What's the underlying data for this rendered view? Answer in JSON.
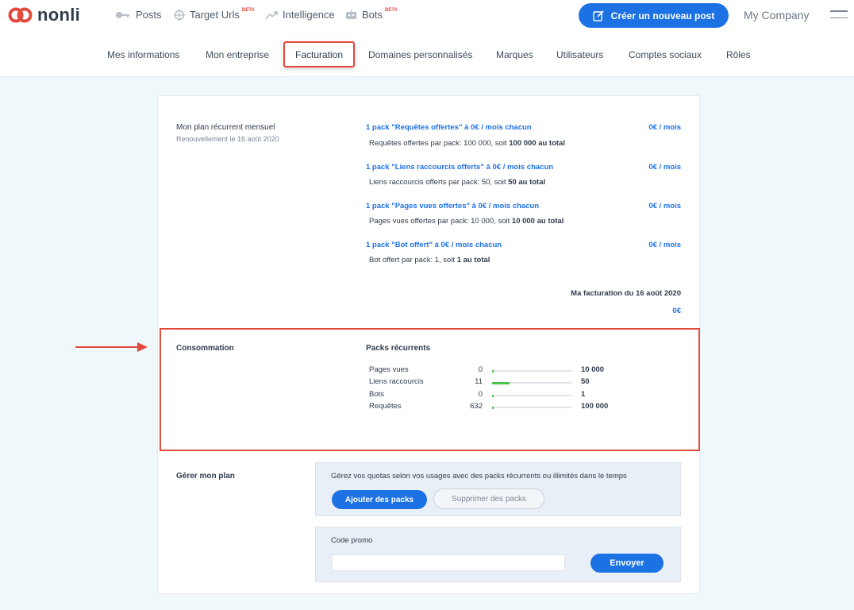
{
  "brand": {
    "name": "nonli",
    "color": "#e24a3e"
  },
  "nav": [
    {
      "label": "Posts",
      "icon": "key-icon",
      "beta": ""
    },
    {
      "label": "Target Urls",
      "icon": "crosshair-icon",
      "beta": "BETA"
    },
    {
      "label": "Intelligence",
      "icon": "trend-icon",
      "beta": ""
    },
    {
      "label": "Bots",
      "icon": "robot-icon",
      "beta": "BETA"
    }
  ],
  "header": {
    "create_label": "Créer un nouveau post",
    "company": "My Company"
  },
  "tabs": [
    "Mes informations",
    "Mon entreprise",
    "Facturation",
    "Domaines personnalisés",
    "Marques",
    "Utilisateurs",
    "Comptes sociaux",
    "Rôles"
  ],
  "plan": {
    "title": "Mon plan récurrent mensuel",
    "renewal": "Renouvellement le 16 août 2020",
    "packs": [
      {
        "title": "1 pack \"Requêtes offertes\" à 0€ / mois chacun",
        "price": "0€ / mois",
        "desc": "Requêtes offertes par pack: 100 000, soit ",
        "desc_bold": "100 000 au total"
      },
      {
        "title": "1 pack \"Liens raccourcis offerts\" à 0€ / mois chacun",
        "price": "0€ / mois",
        "desc": "Liens raccourcis offerts par pack: 50, soit ",
        "desc_bold": "50 au total"
      },
      {
        "title": "1 pack \"Pages vues offertes\" à 0€ / mois chacun",
        "price": "0€ / mois",
        "desc": "Pages vues offertes par pack: 10 000, soit ",
        "desc_bold": "10 000 au total"
      },
      {
        "title": "1 pack \"Bot offert\" à 0€ / mois chacun",
        "price": "0€ / mois",
        "desc": "Bot offert par pack: 1, soit ",
        "desc_bold": "1 au total"
      }
    ],
    "billing_label": "Ma facturation du 16 août 2020",
    "billing_amount": "0€"
  },
  "consumption": {
    "title": "Consommation",
    "packs_title": "Packs récurrents",
    "rows": [
      {
        "label": "Pages vues",
        "used": "0",
        "max": "10 000",
        "fill": 0.0
      },
      {
        "label": "Liens raccourcis",
        "used": "11",
        "max": "50",
        "fill": 0.22
      },
      {
        "label": "Bots",
        "used": "0",
        "max": "1",
        "fill": 0.0
      },
      {
        "label": "Requêtes",
        "used": "632",
        "max": "100 000",
        "fill": 0.0063
      }
    ]
  },
  "manage": {
    "title": "Gérer mon plan",
    "info": "Gérez vos quotas selon vos usages avec des packs récurrents ou illimités dans le temps",
    "add_label": "Ajouter des packs",
    "remove_label": "Supprimer des packs",
    "promo_label": "Code promo",
    "promo_value": "",
    "send_label": "Envoyer"
  },
  "colors": {
    "accent": "#1d72e3",
    "highlight": "#e24a3e",
    "bar": "#4cc34a"
  }
}
